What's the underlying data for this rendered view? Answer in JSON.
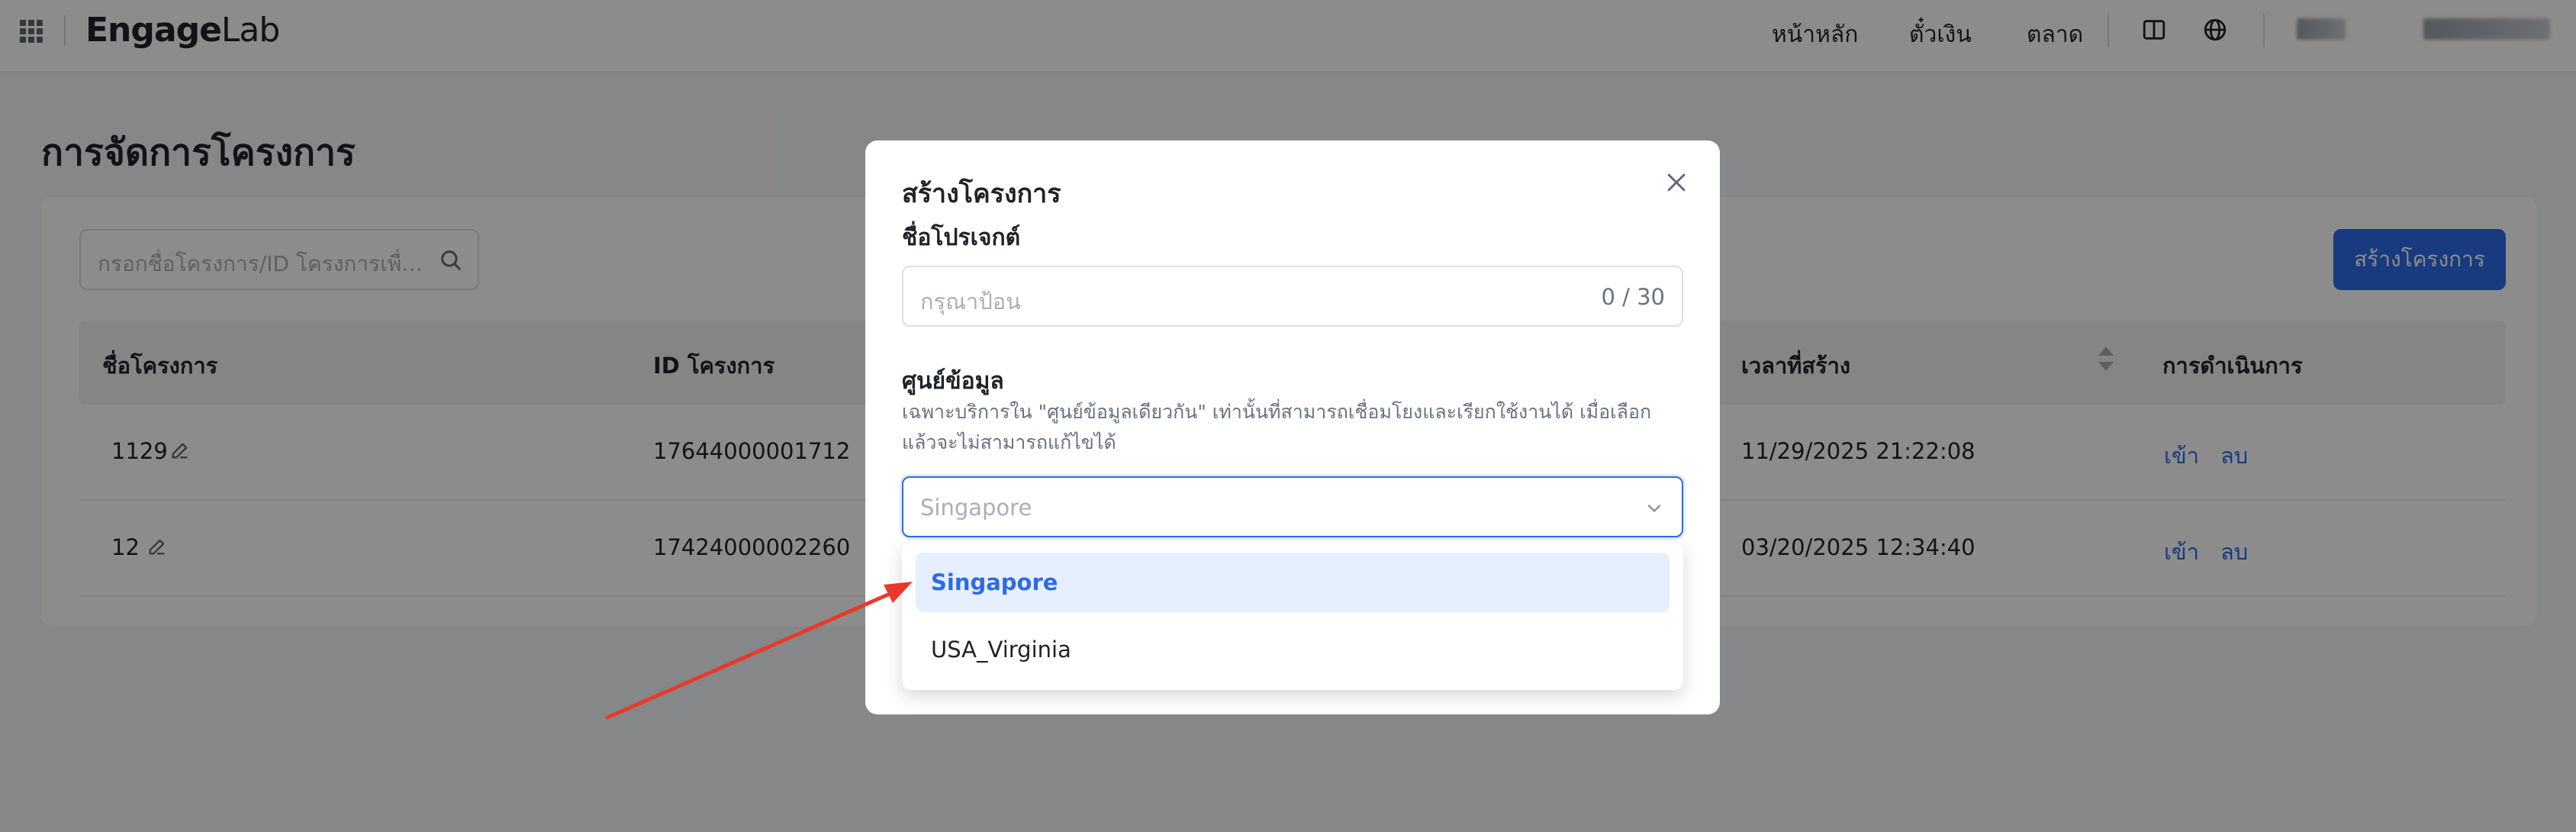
{
  "topbar": {
    "logo_main": "Engage",
    "logo_sub": "Lab",
    "nav": [
      "หน้าหลัก",
      "ตั๋วเงิน",
      "ตลาด"
    ]
  },
  "page": {
    "title": "การจัดการโครงการ",
    "search_placeholder": "กรอกชื่อโครงการ/ID โครงการเพื่อค้...",
    "create_button": "สร้างโครงการ",
    "columns": [
      "ชื่อโครงการ",
      "ID โครงการ",
      "เวลาที่สร้าง",
      "การดำเนินการ"
    ],
    "rows": [
      {
        "name": "1129",
        "id": "17644000001712",
        "created": "11/29/2025 21:22:08",
        "enter": "เข้า",
        "delete": "ลบ"
      },
      {
        "name": "12",
        "id": "17424000002260",
        "created": "03/20/2025 12:34:40",
        "enter": "เข้า",
        "delete": "ลบ"
      }
    ]
  },
  "modal": {
    "title": "สร้างโครงการ",
    "name_label": "ชื่อโปรเจกต์",
    "name_placeholder": "กรุณาป้อน",
    "name_counter": "0 / 30",
    "datacenter_label": "ศูนย์ข้อมูล",
    "datacenter_hint": "เฉพาะบริการใน \"ศูนย์ข้อมูลเดียวกัน\" เท่านั้นที่สามารถเชื่อมโยงและเรียกใช้งานได้ เมื่อเลือกแล้วจะไม่สามารถแก้ไขได้",
    "datacenter_value": "Singapore",
    "options": [
      "Singapore",
      "USA_Virginia"
    ]
  },
  "colors": {
    "primary": "#2d6ae6",
    "annotation_arrow": "#e8392c"
  }
}
